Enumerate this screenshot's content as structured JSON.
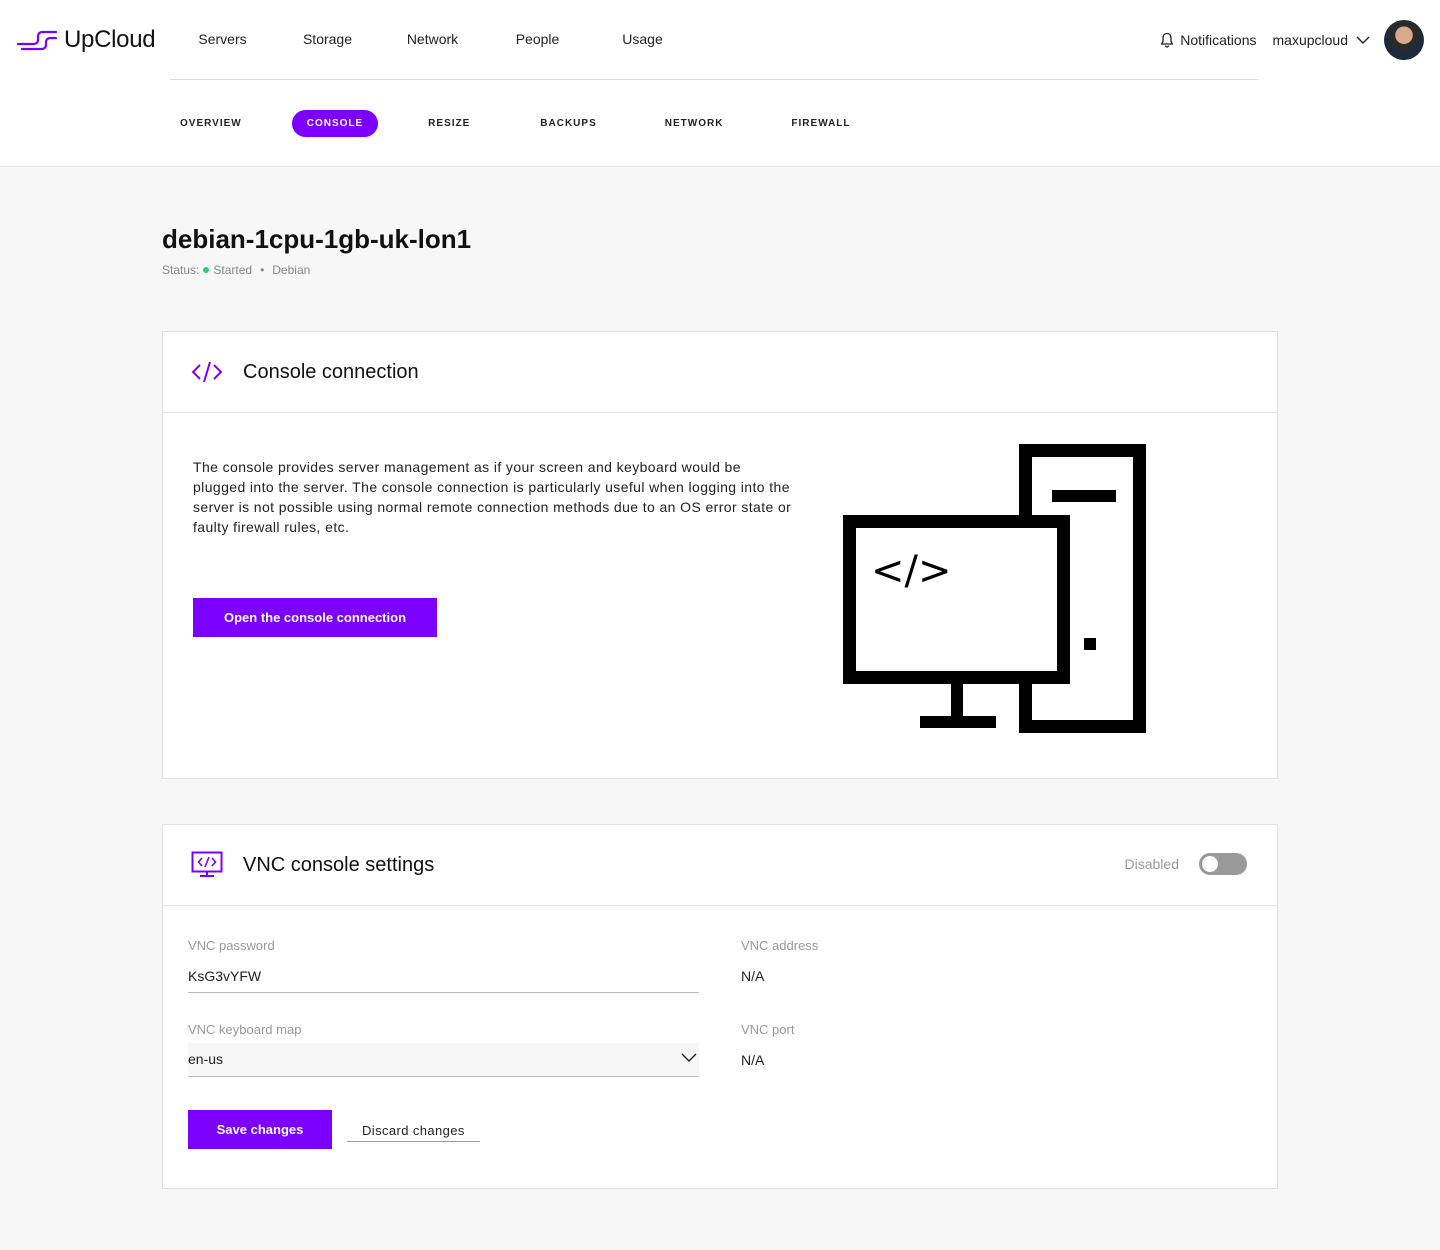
{
  "brand": {
    "name": "UpCloud",
    "accent": "#7b00ff"
  },
  "main_nav": [
    "Servers",
    "Storage",
    "Network",
    "People",
    "Usage"
  ],
  "header": {
    "notifications_label": "Notifications",
    "username": "maxupcloud"
  },
  "tabs": [
    {
      "label": "OVERVIEW",
      "active": false
    },
    {
      "label": "CONSOLE",
      "active": true
    },
    {
      "label": "RESIZE",
      "active": false
    },
    {
      "label": "BACKUPS",
      "active": false
    },
    {
      "label": "NETWORK",
      "active": false
    },
    {
      "label": "FIREWALL",
      "active": false
    }
  ],
  "server": {
    "name": "debian-1cpu-1gb-uk-lon1",
    "status_label": "Status:",
    "status": "Started",
    "status_color": "#2ecc71",
    "separator": "•",
    "os": "Debian"
  },
  "console_card": {
    "title": "Console connection",
    "icon": "code-icon",
    "description": "The console provides server management as if your screen and keyboard would be plugged into the server. The console connection is particularly useful when logging into the server is not possible using normal remote connection methods due to an OS error state or faulty firewall rules, etc.",
    "button_label": "Open the console connection",
    "illustration": "computer-code-icon",
    "illustration_code": "</>"
  },
  "vnc_card": {
    "title": "VNC console settings",
    "icon": "monitor-code-icon",
    "toggle_label": "Disabled",
    "toggle_on": false,
    "password_label": "VNC password",
    "password_value": "KsG3vYFW",
    "keymap_label": "VNC keyboard map",
    "keymap_value": "en-us",
    "address_label": "VNC address",
    "address_value": "N/A",
    "port_label": "VNC port",
    "port_value": "N/A",
    "save_label": "Save changes",
    "discard_label": "Discard changes"
  }
}
